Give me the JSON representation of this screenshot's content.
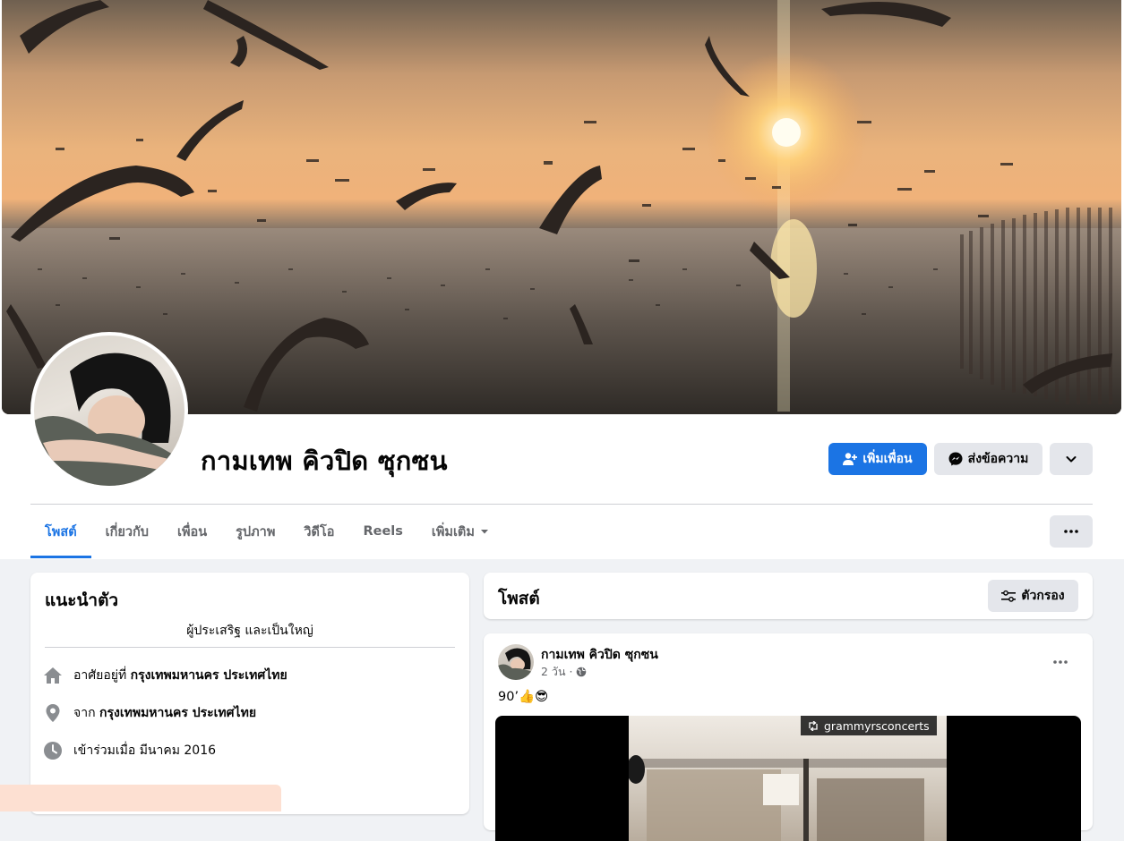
{
  "profile": {
    "name": "กามเทพ คิวปิด ซุกซน",
    "add_friend_label": "เพิ่มเพื่อน",
    "message_label": "ส่งข้อความ"
  },
  "tabs": [
    {
      "label": "โพสต์"
    },
    {
      "label": "เกี่ยวกับ"
    },
    {
      "label": "เพื่อน"
    },
    {
      "label": "รูปภาพ"
    },
    {
      "label": "วิดีโอ"
    },
    {
      "label": "Reels"
    },
    {
      "label": "เพิ่มเติม"
    }
  ],
  "intro": {
    "title": "แนะนำตัว",
    "bio": "ผู้ประเสริฐ และเป็นใหญ่",
    "lives_prefix": "อาศัยอยู่ที่",
    "lives_value": "กรุงเทพมหานคร ประเทศไทย",
    "from_prefix": "จาก",
    "from_value": "กรุงเทพมหานคร ประเทศไทย",
    "joined": "เข้าร่วมเมื่อ มีนาคม 2016"
  },
  "posts": {
    "title": "โพสต์",
    "filter_label": "ตัวกรอง"
  },
  "post": {
    "author": "กามเทพ คิวปิด ซุกซน",
    "time": "2 วัน ·",
    "text": "90’👍😎",
    "media_tag": "grammyrsconcerts"
  },
  "colors": {
    "accent": "#1b74e4",
    "grey_button": "#e4e6eb",
    "page_bg": "#f0f2f5"
  }
}
